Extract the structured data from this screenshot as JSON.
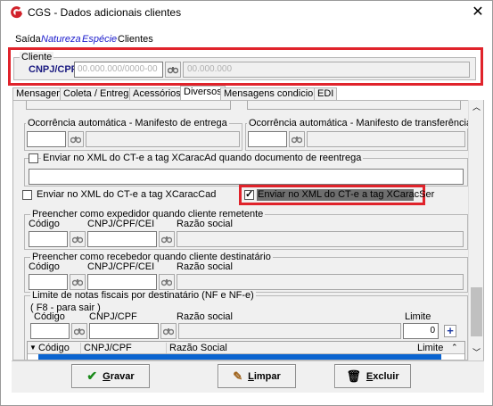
{
  "window": {
    "title": "CGS - Dados adicionais clientes",
    "close_label": "✕"
  },
  "menu": [
    {
      "label": "Saída",
      "style": "normal"
    },
    {
      "label": "Natureza",
      "style": "blue"
    },
    {
      "label": "Espécie",
      "style": "blue"
    },
    {
      "label": "Clientes",
      "style": "normal"
    }
  ],
  "cliente": {
    "group_title": "Cliente",
    "cnpj_label": "CNPJ/CPF",
    "cnpj_value": "00.000.000/0000-00",
    "name_value": "00.000.000"
  },
  "tabs": [
    {
      "label": "Mensagens",
      "active": false
    },
    {
      "label": "Coleta / Entrega",
      "active": false
    },
    {
      "label": "Acessórios",
      "active": false
    },
    {
      "label": "Diversos",
      "active": true
    },
    {
      "label": "Mensagens condicionais",
      "active": false
    },
    {
      "label": "EDI",
      "active": false
    }
  ],
  "diversos": {
    "ocorrencia_entrega_title": "Ocorrência automática - Manifesto de entrega",
    "ocorrencia_transferencia_title": "Ocorrência automática - Manifesto de transferência",
    "xml_reentrega_label": "Enviar no XML do CT-e a tag XCaracAd quando documento de reentrega",
    "xml_caraccad_label": "Enviar no XML do CT-e a tag XCaracCad",
    "xml_caracser_label": "Enviar no XML do CT-e a tag XCaracSer",
    "xml_caracser_checked": true,
    "expedidor_title": "Preencher como expedidor quando cliente remetente",
    "recebedor_title": "Preencher como recebedor quando cliente destinatário",
    "codigo_label": "Código",
    "cnpj_cpf_cei_label": "CNPJ/CPF/CEI",
    "razao_social_label": "Razão social",
    "limite_group_title": "Limite de notas fiscais por destinatário (NF e NF-e)",
    "f8_hint": "( F8 - para sair )",
    "limite_codigo_label": "Código",
    "limite_cnpj_label": "CNPJ/CPF",
    "limite_razao_label": "Razão social",
    "limite_label": "Limite",
    "limite_value": "0",
    "grid_headers": [
      "Código",
      "CNPJ/CPF",
      "Razão Social",
      "Limite"
    ]
  },
  "buttons": {
    "gravar_prefix": "",
    "gravar_u": "G",
    "gravar_rest": "ravar",
    "limpar_u": "L",
    "limpar_rest": "impar",
    "excluir_u": "E",
    "excluir_rest": "xcluir"
  },
  "colors": {
    "highlight": "#e0232b",
    "accent_blue": "#1a1acc",
    "selection": "#0a64d0"
  }
}
